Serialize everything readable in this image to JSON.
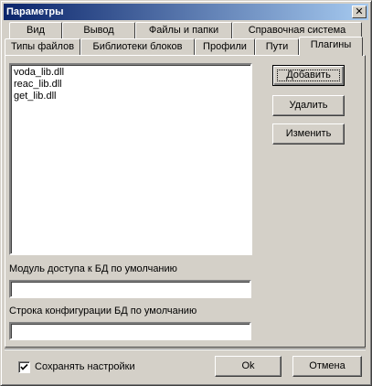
{
  "window": {
    "title": "Параметры",
    "close_glyph": "✕"
  },
  "tabs_row1": [
    "Вид",
    "Вывод",
    "Файлы и папки",
    "Справочная система"
  ],
  "tabs_row2": [
    "Типы файлов",
    "Библиотеки блоков",
    "Профили",
    "Пути",
    "Плагины"
  ],
  "selected_tab": "Плагины",
  "plugins": {
    "items": [
      "voda_lib.dll",
      "reac_lib.dll",
      "get_lib.dll"
    ],
    "buttons": {
      "add": "Добавить",
      "remove": "Удалить",
      "edit": "Изменить"
    }
  },
  "db_module": {
    "label": "Модуль доступа к БД по умолчанию",
    "value": ""
  },
  "db_config": {
    "label": "Строка конфигурации БД по умолчанию",
    "value": ""
  },
  "footer": {
    "save_settings_label": "Сохранять настройки",
    "save_settings_checked": true,
    "ok_label": "Ok",
    "cancel_label": "Отмена"
  },
  "icons": {
    "close": "close-icon",
    "check": "checkmark-icon"
  }
}
